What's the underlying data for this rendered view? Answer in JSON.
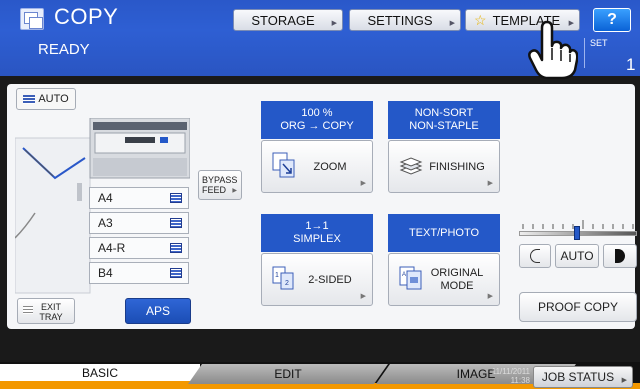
{
  "header": {
    "app_title": "COPY",
    "status": "READY",
    "buttons": {
      "storage": "STORAGE",
      "settings": "SETTINGS",
      "template": "TEMPLATE",
      "help": "?"
    },
    "set_label": "SET",
    "set_count": "1"
  },
  "main": {
    "auto_label": "AUTO",
    "bypass_label_1": "BYPASS",
    "bypass_label_2": "FEED",
    "trays": [
      "A4",
      "A3",
      "A4-R",
      "B4"
    ],
    "exit_tray_1": "EXIT",
    "exit_tray_2": "TRAY",
    "aps_label": "APS",
    "zoom": {
      "head_1": "100 %",
      "head_2": "ORG → COPY",
      "label": "ZOOM"
    },
    "finishing": {
      "head_1": "NON-SORT",
      "head_2": "NON-STAPLE",
      "label": "FINISHING"
    },
    "sided": {
      "head_1": "1→1",
      "head_2": "SIMPLEX",
      "label": "2-SIDED"
    },
    "original": {
      "head_1": "TEXT/PHOTO",
      "label_1": "ORIGINAL",
      "label_2": "MODE"
    },
    "density": {
      "auto_label": "AUTO"
    },
    "proof_copy_label": "PROOF COPY"
  },
  "tabs": [
    {
      "label": "BASIC",
      "active": true
    },
    {
      "label": "EDIT",
      "active": false
    },
    {
      "label": "IMAGE",
      "active": false
    }
  ],
  "footer": {
    "date": "11/11/2011",
    "time": "11:38",
    "job_status_label": "JOB STATUS"
  },
  "colors": {
    "header_blue": "#2e5fd3",
    "function_head_blue": "#2458c8",
    "tab_accent": "#f39800"
  }
}
